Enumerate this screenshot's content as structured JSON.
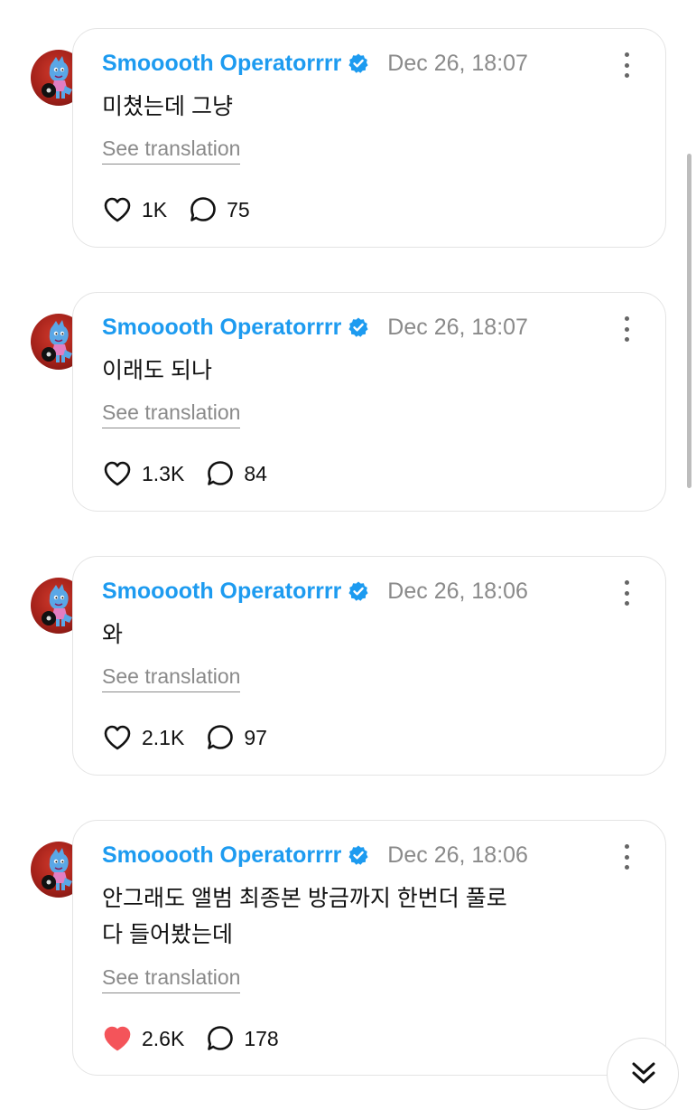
{
  "posts": [
    {
      "username": "Smooooth Operatorrrr",
      "date": "Dec 26, 18:07",
      "text_lines": [
        "미쳤는데 그냥"
      ],
      "see_translation": "See translation",
      "likes": "1K",
      "comments": "75",
      "liked": false
    },
    {
      "username": "Smooooth Operatorrrr",
      "date": "Dec 26, 18:07",
      "text_lines": [
        "이래도 되나"
      ],
      "see_translation": "See translation",
      "likes": "1.3K",
      "comments": "84",
      "liked": false
    },
    {
      "username": "Smooooth Operatorrrr",
      "date": "Dec 26, 18:06",
      "text_lines": [
        "와"
      ],
      "see_translation": "See translation",
      "likes": "2.1K",
      "comments": "97",
      "liked": false
    },
    {
      "username": "Smooooth Operatorrrr",
      "date": "Dec 26, 18:06",
      "text_lines": [
        "안그래도 앨범 최종본 방금까지 한번더 풀로",
        "다 들어봤는데"
      ],
      "see_translation": "See translation",
      "likes": "2.6K",
      "comments": "178",
      "liked": true
    }
  ],
  "colors": {
    "username": "#1d9bf0",
    "verified_badge": "#1d9bf0",
    "liked_heart": "#f4545a",
    "muted_text": "#8a8a8a",
    "avatar_bg": "#a3211a"
  },
  "icons": {
    "verified": "verified-badge-icon",
    "more": "more-vertical-icon",
    "like": "heart-icon",
    "comment": "speech-bubble-icon",
    "scroll_down": "double-chevron-down-icon"
  }
}
